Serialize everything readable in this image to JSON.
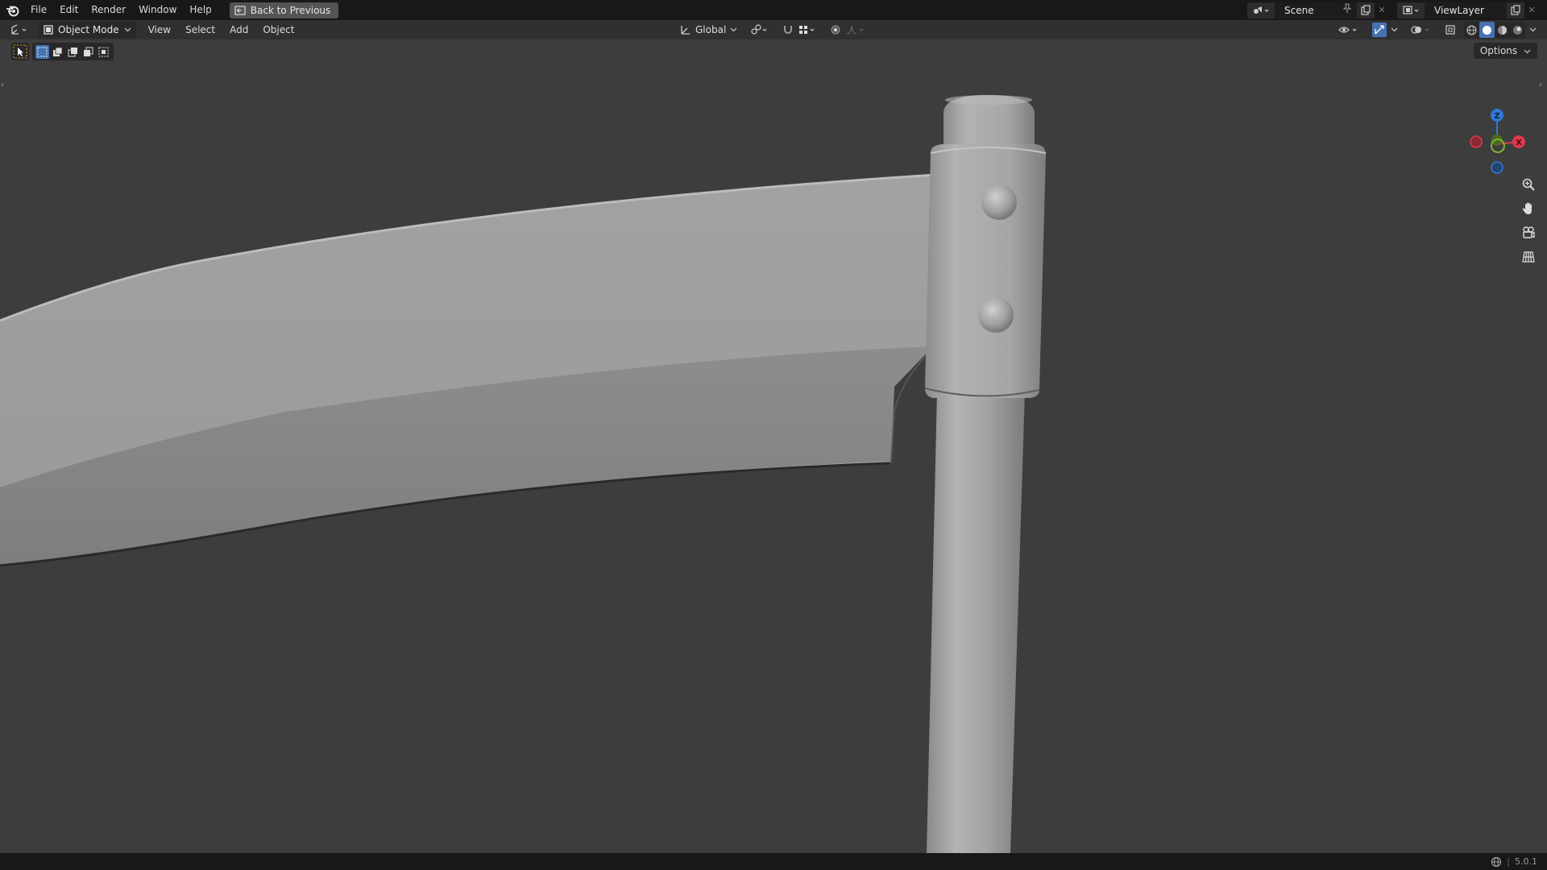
{
  "topbar": {
    "menus": [
      "File",
      "Edit",
      "Render",
      "Window",
      "Help"
    ],
    "back_label": "Back to Previous",
    "scene_name": "Scene",
    "view_layer": "ViewLayer"
  },
  "header": {
    "mode_label": "Object Mode",
    "menus": [
      "View",
      "Select",
      "Add",
      "Object"
    ],
    "orientation": "Global"
  },
  "toolbar": {
    "options_label": "Options"
  },
  "gizmo": {
    "axis_z": "Z",
    "axis_x": "X",
    "colors": {
      "x": "#e0384c",
      "y": "#7fb433",
      "z": "#2f78d8"
    }
  },
  "status": {
    "version": "5.0.1"
  },
  "colors": {
    "accent": "#4772b3",
    "viewport_bg": "#3d3d3d",
    "model": "#a9a9a9"
  }
}
